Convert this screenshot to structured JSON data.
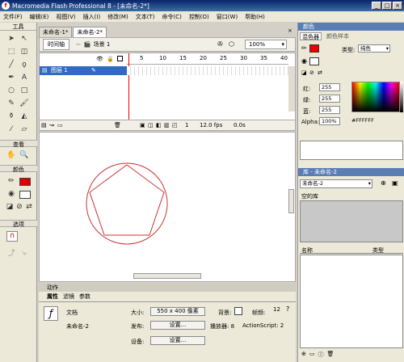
{
  "window": {
    "title": "Macromedia Flash Professional 8 - [未命名-2*]",
    "icon": "flash-app-icon"
  },
  "menu": [
    "文件(F)",
    "编辑(E)",
    "视图(V)",
    "插入(I)",
    "修改(M)",
    "文本(T)",
    "命令(C)",
    "控制(O)",
    "窗口(W)",
    "帮助(H)"
  ],
  "toolbox": {
    "title": "工具",
    "view_label": "查看",
    "colors_label": "颜色",
    "options_label": "选项"
  },
  "doc_tabs": [
    "未命名-1*",
    "未命名-2*"
  ],
  "timeline": {
    "toggle_label": "时间轴",
    "scene_label": "场景 1",
    "zoom": "100%",
    "layer_name": "图层 1",
    "ruler": [
      "5",
      "10",
      "15",
      "20",
      "25",
      "30",
      "35",
      "40"
    ],
    "frame": "1",
    "fps": "12.0 fps",
    "time": "0.0s"
  },
  "panels": {
    "actions": "动作",
    "tabs": [
      "属性",
      "滤镜",
      "参数"
    ]
  },
  "props": {
    "doc_label": "文档",
    "doc_name": "未命名-2",
    "size_label": "大小:",
    "size_value": "550 x 400 像素",
    "bg_label": "背景:",
    "fps_label": "帧频:",
    "fps_value": "12",
    "publish_label": "发布:",
    "settings_btn": "设置...",
    "player_label": "播放器: 8",
    "as_label": "ActionScript: 2",
    "device_label": "设备:",
    "device_btn": "设置..."
  },
  "color_panel": {
    "title": "颜色",
    "tabs": [
      "混色器",
      "颜色样本"
    ],
    "type_label": "类型:",
    "type_value": "纯色",
    "r_label": "红:",
    "r": "255",
    "g_label": "绿:",
    "g": "255",
    "b_label": "蓝:",
    "b": "255",
    "alpha_label": "Alpha:",
    "alpha": "100%",
    "hex": "#FFFFFF"
  },
  "library": {
    "title": "库 - 未命名-2",
    "doc": "未命名-2",
    "empty": "空的库",
    "col_name": "名称",
    "col_type": "类型"
  },
  "colors": {
    "stroke": "#cc3333",
    "fill": "#ff0000"
  }
}
